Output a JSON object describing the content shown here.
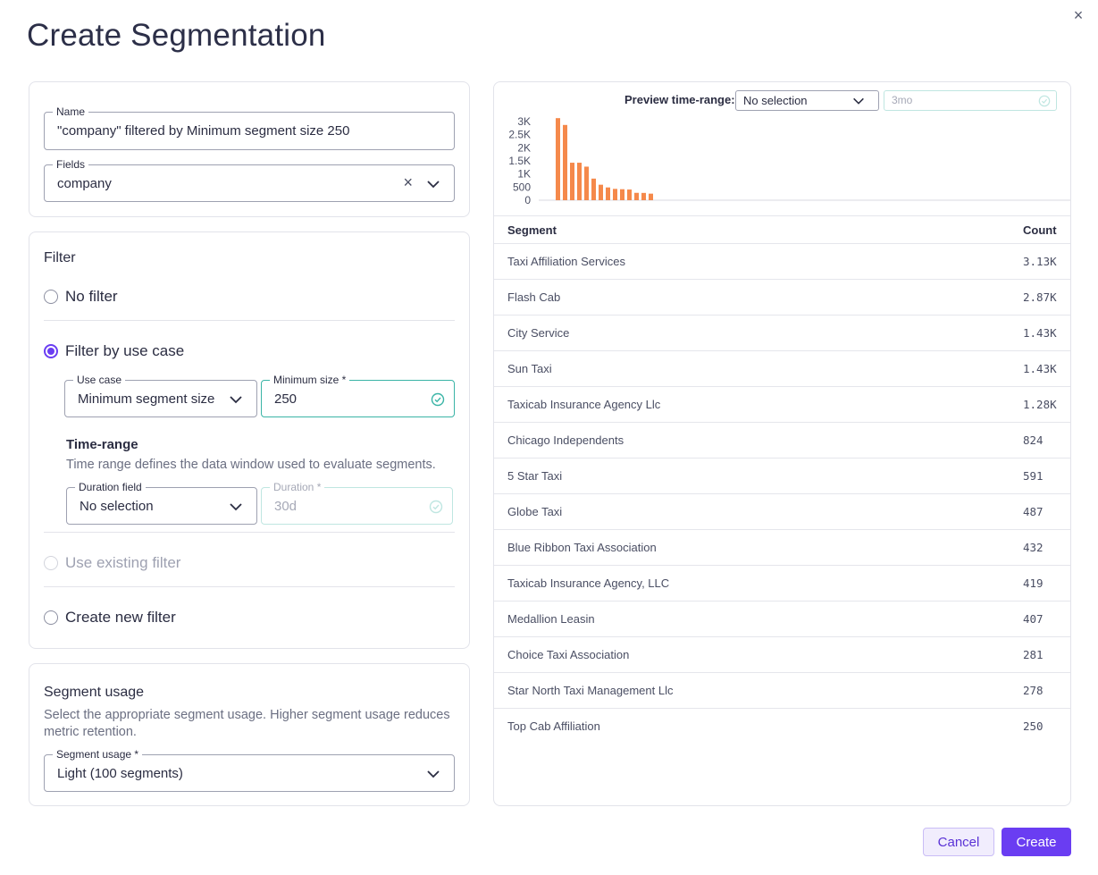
{
  "title": "Create Segmentation",
  "close_glyph": "×",
  "name_field": {
    "label": "Name",
    "value": "\"company\" filtered by Minimum segment size 250"
  },
  "fields_field": {
    "label": "Fields",
    "value": "company",
    "clear_glyph": "×"
  },
  "filter": {
    "title": "Filter",
    "options": {
      "no_filter": "No filter",
      "by_use_case": "Filter by use case",
      "existing": "Use existing filter",
      "create_new": "Create new filter"
    },
    "selected": "by_use_case",
    "use_case": {
      "label": "Use case",
      "value": "Minimum segment size"
    },
    "min_size": {
      "label": "Minimum size *",
      "value": "250"
    },
    "time_range": {
      "heading": "Time-range",
      "description": "Time range defines the data window used to evaluate segments.",
      "duration_field": {
        "label": "Duration field",
        "value": "No selection"
      },
      "duration": {
        "label": "Duration *",
        "value": "30d"
      }
    }
  },
  "segment_usage": {
    "title": "Segment usage",
    "description": "Select the appropriate segment usage. Higher segment usage reduces metric retention.",
    "field": {
      "label": "Segment usage *",
      "value": "Light (100 segments)"
    }
  },
  "preview": {
    "time_range_label": "Preview time-range:",
    "time_range_value": "No selection",
    "range_input": "3mo"
  },
  "chart_data": {
    "type": "bar",
    "y_ticks": [
      "3K",
      "2.5K",
      "2K",
      "1.5K",
      "1K",
      "500",
      "0"
    ],
    "ylim": [
      0,
      3000
    ],
    "values": [
      3130,
      2870,
      1430,
      1430,
      1280,
      824,
      591,
      487,
      432,
      419,
      407,
      281,
      278,
      250
    ],
    "bar_color": "#f5894b"
  },
  "table": {
    "headers": {
      "segment": "Segment",
      "count": "Count"
    },
    "rows": [
      {
        "segment": "Taxi Affiliation Services",
        "count": "3.13K"
      },
      {
        "segment": "Flash Cab",
        "count": "2.87K"
      },
      {
        "segment": "City Service",
        "count": "1.43K"
      },
      {
        "segment": "Sun Taxi",
        "count": "1.43K"
      },
      {
        "segment": "Taxicab Insurance Agency Llc",
        "count": "1.28K"
      },
      {
        "segment": "Chicago Independents",
        "count": "824"
      },
      {
        "segment": "5 Star Taxi",
        "count": "591"
      },
      {
        "segment": "Globe Taxi",
        "count": "487"
      },
      {
        "segment": "Blue Ribbon Taxi Association",
        "count": "432"
      },
      {
        "segment": "Taxicab Insurance Agency, LLC",
        "count": "419"
      },
      {
        "segment": "Medallion Leasin",
        "count": "407"
      },
      {
        "segment": "Choice Taxi Association",
        "count": "281"
      },
      {
        "segment": "Star North Taxi Management Llc",
        "count": "278"
      },
      {
        "segment": "Top Cab Affiliation",
        "count": "250"
      }
    ]
  },
  "buttons": {
    "cancel": "Cancel",
    "create": "Create"
  },
  "colors": {
    "accent": "#6a3df2",
    "valid": "#3ab4a6",
    "bar": "#f5894b"
  }
}
